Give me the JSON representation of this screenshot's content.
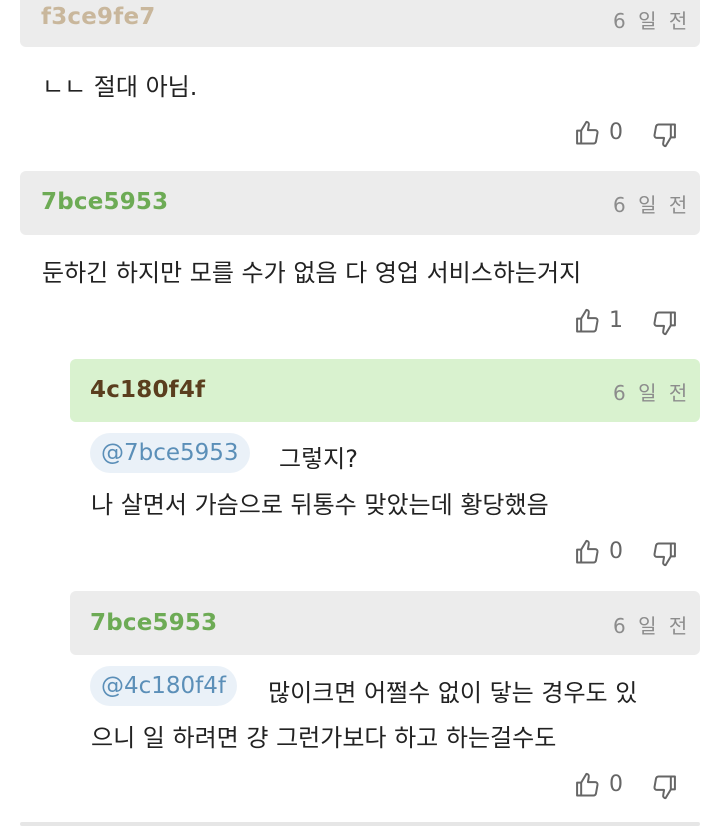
{
  "colors": {
    "author_tan": "#c9b79c",
    "author_green": "#6dab55",
    "author_brown": "#5a3e1e"
  },
  "icons": {
    "like": "thumbs-up-outline",
    "dislike": "thumbs-down-outline"
  },
  "comments": [
    {
      "author": "f3ce9fe7",
      "time": "6 일 전",
      "lines": [
        "ㄴㄴ 절대 아님."
      ],
      "likes": "0"
    },
    {
      "author": "7bce5953",
      "time": "6 일 전",
      "lines": [
        "둔하긴 하지만 모를 수가 없음 다 영업 서비스하는거지"
      ],
      "likes": "1"
    },
    {
      "author": "4c180f4f",
      "time": "6 일 전",
      "mention": "@7bce5953",
      "lines": [
        "그렇지?",
        "나 살면서 가슴으로 뒤통수 맞았는데 황당했음"
      ],
      "likes": "0"
    },
    {
      "author": "7bce5953",
      "time": "6 일 전",
      "mention": "@4c180f4f",
      "lines": [
        "많이크면 어쩔수 없이 닿는 경우도 있",
        "으니 일 하려면 걍 그런가보다 하고 하는걸수도"
      ],
      "likes": "0"
    }
  ]
}
